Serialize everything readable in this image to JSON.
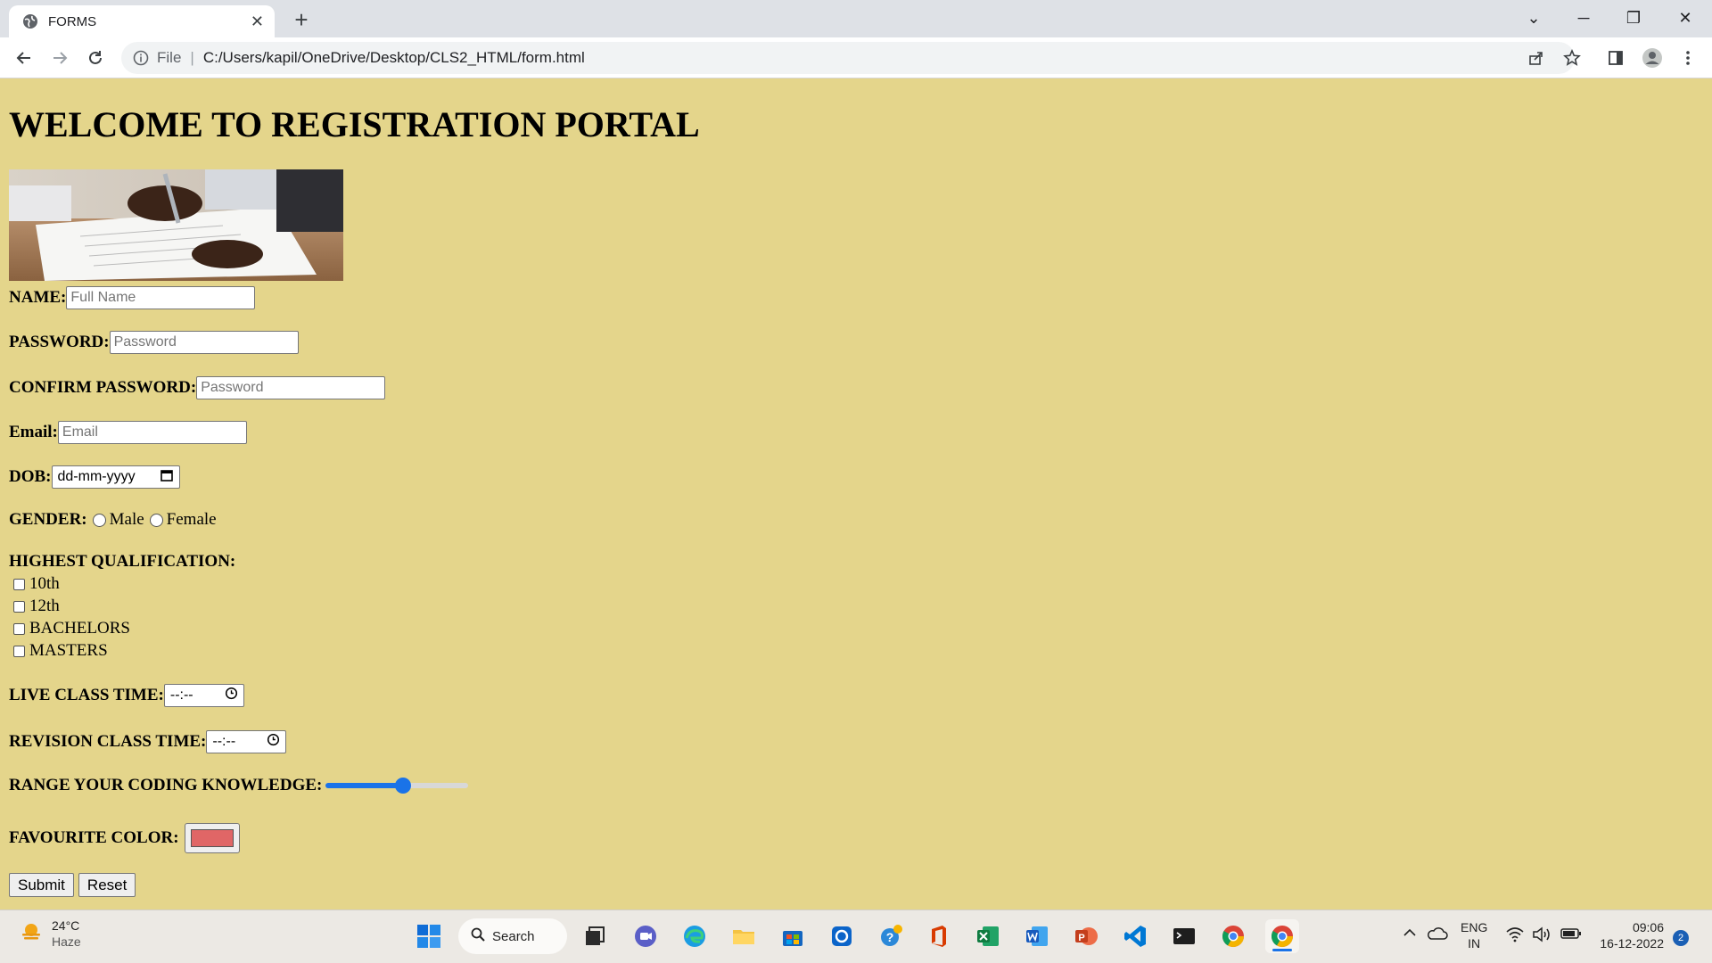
{
  "browser": {
    "tab_title": "FORMS",
    "address_scheme_label": "File",
    "address_separator": "|",
    "address_path": "C:/Users/kapil/OneDrive/Desktop/CLS2_HTML/form.html"
  },
  "page": {
    "heading": "WELCOME TO REGISTRATION PORTAL",
    "name": {
      "label": "NAME:",
      "placeholder": "Full Name"
    },
    "password": {
      "label": "PASSWORD:",
      "placeholder": "Password"
    },
    "confirm_password": {
      "label": "CONFIRM PASSWORD:",
      "placeholder": "Password"
    },
    "email": {
      "label": "Email:",
      "placeholder": "Email"
    },
    "dob": {
      "label": "DOB:",
      "placeholder": "dd-mm-yyyy"
    },
    "gender": {
      "label": "GENDER:",
      "options": [
        "Male",
        "Female"
      ]
    },
    "qualification": {
      "label": "HIGHEST QUALIFICATION:",
      "options": [
        "10th",
        "12th",
        "BACHELORS",
        "MASTERS"
      ]
    },
    "live_class_time": {
      "label": "LIVE CLASS TIME:",
      "placeholder": "--:--"
    },
    "revision_class_time": {
      "label": "REVISION CLASS TIME:",
      "placeholder": "--:--"
    },
    "coding_range": {
      "label": "RANGE YOUR CODING KNOWLEDGE:",
      "value_fraction": 0.55
    },
    "favourite_color": {
      "label": "FAVOURITE COLOR:",
      "value": "#e06666"
    },
    "buttons": {
      "submit": "Submit",
      "reset": "Reset"
    }
  },
  "taskbar": {
    "weather_temp": "24°C",
    "weather_desc": "Haze",
    "search_label": "Search",
    "lang_top": "ENG",
    "lang_bottom": "IN",
    "time": "09:06",
    "date": "16-12-2022",
    "notification_count": "2"
  },
  "colors": {
    "page_background": "#e4d58b",
    "slider_accent": "#1a73e8"
  }
}
